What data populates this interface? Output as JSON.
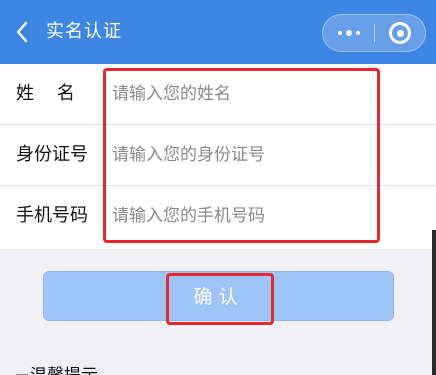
{
  "navbar": {
    "title": "实名认证",
    "back_icon": "chevron-left-icon",
    "more_icon": "more-dots-icon",
    "close_icon": "target-circle-icon",
    "background": "#3d86e3"
  },
  "form": {
    "fields": [
      {
        "label": "姓    名",
        "placeholder": "请输入您的姓名"
      },
      {
        "label": "身份证号",
        "placeholder": "请输入您的身份证号"
      },
      {
        "label": "手机号码",
        "placeholder": "请输入您的手机号码"
      }
    ]
  },
  "confirm": {
    "label": "确认",
    "background": "#9ec5f7"
  },
  "tips": {
    "title": "温馨提示"
  },
  "annotation_color": "#e8262c"
}
